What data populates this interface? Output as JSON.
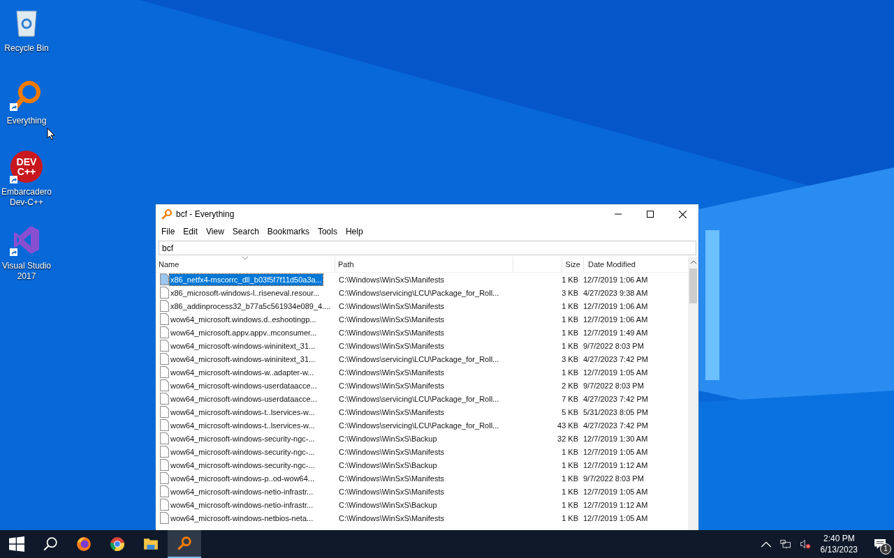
{
  "desktop_icons": [
    {
      "kind": "recycle",
      "label": "Recycle Bin",
      "shortcut": false
    },
    {
      "kind": "magnifier",
      "label": "Everything",
      "shortcut": true
    },
    {
      "kind": "devcpp",
      "label": "Embarcadero Dev-C++",
      "shortcut": true,
      "icon_text": [
        "DEV",
        "C++"
      ]
    },
    {
      "kind": "vs",
      "label": "Visual Studio 2017",
      "shortcut": true
    }
  ],
  "window": {
    "title": "bcf - Everything",
    "menu": [
      "File",
      "Edit",
      "View",
      "Search",
      "Bookmarks",
      "Tools",
      "Help"
    ],
    "search": {
      "value": "bcf"
    },
    "table": {
      "columns": [
        "Name",
        "Path",
        "Size",
        "Date Modified"
      ],
      "rows": [
        {
          "name": "x86_netfx4-mscorrc_dll_b03f5f7f11d50a3a...",
          "path": "C:\\Windows\\WinSxS\\Manifests",
          "size": "1 KB",
          "date": "12/7/2019 1:06 AM",
          "selected": true
        },
        {
          "name": "x86_microsoft-windows-l..riseneval.resour...",
          "path": "C:\\Windows\\servicing\\LCU\\Package_for_Roll...",
          "size": "3 KB",
          "date": "4/27/2023 9:38 AM",
          "selected": false
        },
        {
          "name": "x86_addinprocess32_b77a5c561934e089_4....",
          "path": "C:\\Windows\\WinSxS\\Manifests",
          "size": "1 KB",
          "date": "12/7/2019 1:06 AM",
          "selected": false
        },
        {
          "name": "wow64_microsoft.windows.d..eshootingp...",
          "path": "C:\\Windows\\WinSxS\\Manifests",
          "size": "1 KB",
          "date": "12/7/2019 1:06 AM",
          "selected": false
        },
        {
          "name": "wow64_microsoft.appv.appv..mconsumer...",
          "path": "C:\\Windows\\WinSxS\\Manifests",
          "size": "1 KB",
          "date": "12/7/2019 1:49 AM",
          "selected": false
        },
        {
          "name": "wow64_microsoft-windows-wininitext_31...",
          "path": "C:\\Windows\\WinSxS\\Manifests",
          "size": "1 KB",
          "date": "9/7/2022 8:03 PM",
          "selected": false
        },
        {
          "name": "wow64_microsoft-windows-wininitext_31...",
          "path": "C:\\Windows\\servicing\\LCU\\Package_for_Roll...",
          "size": "3 KB",
          "date": "4/27/2023 7:42 PM",
          "selected": false
        },
        {
          "name": "wow64_microsoft-windows-w..adapter-w...",
          "path": "C:\\Windows\\WinSxS\\Manifests",
          "size": "1 KB",
          "date": "12/7/2019 1:05 AM",
          "selected": false
        },
        {
          "name": "wow64_microsoft-windows-userdataacce...",
          "path": "C:\\Windows\\WinSxS\\Manifests",
          "size": "2 KB",
          "date": "9/7/2022 8:03 PM",
          "selected": false
        },
        {
          "name": "wow64_microsoft-windows-userdataacce...",
          "path": "C:\\Windows\\servicing\\LCU\\Package_for_Roll...",
          "size": "7 KB",
          "date": "4/27/2023 7:42 PM",
          "selected": false
        },
        {
          "name": "wow64_microsoft-windows-t..lservices-w...",
          "path": "C:\\Windows\\WinSxS\\Manifests",
          "size": "5 KB",
          "date": "5/31/2023 8:05 PM",
          "selected": false
        },
        {
          "name": "wow64_microsoft-windows-t..lservices-w...",
          "path": "C:\\Windows\\servicing\\LCU\\Package_for_Roll...",
          "size": "43 KB",
          "date": "4/27/2023 7:42 PM",
          "selected": false
        },
        {
          "name": "wow64_microsoft-windows-security-ngc-...",
          "path": "C:\\Windows\\WinSxS\\Backup",
          "size": "32 KB",
          "date": "12/7/2019 1:30 AM",
          "selected": false
        },
        {
          "name": "wow64_microsoft-windows-security-ngc-...",
          "path": "C:\\Windows\\WinSxS\\Manifests",
          "size": "1 KB",
          "date": "12/7/2019 1:05 AM",
          "selected": false
        },
        {
          "name": "wow64_microsoft-windows-security-ngc-...",
          "path": "C:\\Windows\\WinSxS\\Backup",
          "size": "1 KB",
          "date": "12/7/2019 1:12 AM",
          "selected": false
        },
        {
          "name": "wow64_microsoft-windows-p..od-wow64...",
          "path": "C:\\Windows\\WinSxS\\Manifests",
          "size": "1 KB",
          "date": "9/7/2022 8:03 PM",
          "selected": false
        },
        {
          "name": "wow64_microsoft-windows-netio-infrastr...",
          "path": "C:\\Windows\\WinSxS\\Manifests",
          "size": "1 KB",
          "date": "12/7/2019 1:05 AM",
          "selected": false
        },
        {
          "name": "wow64_microsoft-windows-netio-infrastr...",
          "path": "C:\\Windows\\WinSxS\\Backup",
          "size": "1 KB",
          "date": "12/7/2019 1:12 AM",
          "selected": false
        },
        {
          "name": "wow64_microsoft-windows-netbios-neta...",
          "path": "C:\\Windows\\WinSxS\\Manifests",
          "size": "1 KB",
          "date": "12/7/2019 1:05 AM",
          "selected": false
        }
      ]
    }
  },
  "taskbar": {
    "apps": [
      {
        "kind": "start",
        "active": false
      },
      {
        "kind": "search",
        "active": false
      },
      {
        "kind": "firefox",
        "active": false
      },
      {
        "kind": "chrome",
        "active": false
      },
      {
        "kind": "folder",
        "active": false
      },
      {
        "kind": "magnifier",
        "active": true
      }
    ],
    "time": "2:40 PM",
    "date": "6/13/2023",
    "notification_count": "1"
  }
}
